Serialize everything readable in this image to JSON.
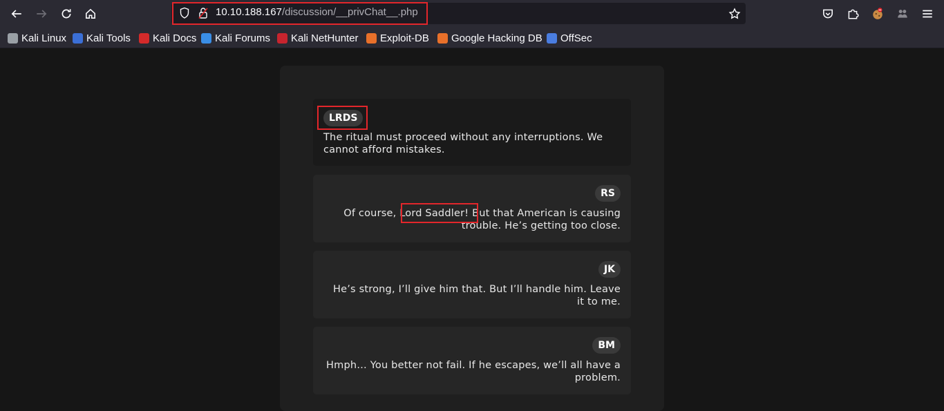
{
  "browser": {
    "url_host": "10.10.188.167",
    "url_path": "/discussion/__privChat__.php",
    "bookmarks": [
      {
        "label": "Kali Linux",
        "icon": "kali-dragon-icon",
        "color": "#9aa0a6"
      },
      {
        "label": "Kali Tools",
        "icon": "kali-tools-icon",
        "color": "#3b6fd6"
      },
      {
        "label": "Kali Docs",
        "icon": "kali-docs-icon",
        "color": "#d42a2a"
      },
      {
        "label": "Kali Forums",
        "icon": "kali-forums-icon",
        "color": "#3a8ee6"
      },
      {
        "label": "Kali NetHunter",
        "icon": "kali-nethunter-icon",
        "color": "#c7242e"
      },
      {
        "label": "Exploit-DB",
        "icon": "exploit-db-icon",
        "color": "#e8702a"
      },
      {
        "label": "Google Hacking DB",
        "icon": "ghdb-icon",
        "color": "#e8702a"
      },
      {
        "label": "OffSec",
        "icon": "offsec-icon",
        "color": "#4a7de0"
      }
    ]
  },
  "chat": {
    "messages": [
      {
        "sender": "LRDS",
        "text": "The ritual must proceed without any interruptions. We cannot afford mistakes."
      },
      {
        "sender": "RS",
        "text_before": "Of course, ",
        "text_highlight": "Lord Saddler!",
        "text_after": " But that American is causing trouble. He’s getting too close."
      },
      {
        "sender": "JK",
        "text": "He’s strong, I’ll give him that. But I’ll handle him. Leave it to me."
      },
      {
        "sender": "BM",
        "text": "Hmph… You better not fail. If he escapes, we’ll all have a problem."
      }
    ]
  },
  "colors": {
    "highlight_box": "#e3262b",
    "toolbar_bg": "#2b2a33",
    "page_bg": "#161616"
  }
}
